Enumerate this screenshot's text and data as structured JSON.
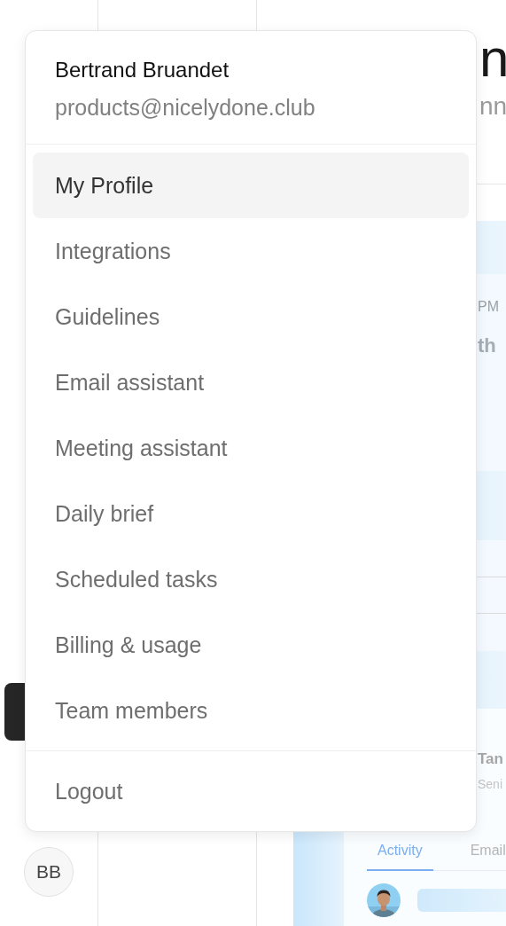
{
  "sidebar": {
    "avatar_initials": "BB"
  },
  "main": {
    "heading": "n",
    "subtitle": "nn",
    "event_time": "PM",
    "event_title": "th",
    "contact_name": "Tan",
    "contact_role": "Seni",
    "tabs": [
      {
        "label": "Activity",
        "selected": true
      },
      {
        "label": "Email",
        "selected": false
      }
    ]
  },
  "user_menu": {
    "name": "Bertrand Bruandet",
    "email": "products@nicelydone.club",
    "items": [
      {
        "label": "My Profile",
        "selected": true
      },
      {
        "label": "Integrations",
        "selected": false
      },
      {
        "label": "Guidelines",
        "selected": false
      },
      {
        "label": "Email assistant",
        "selected": false
      },
      {
        "label": "Meeting assistant",
        "selected": false
      },
      {
        "label": "Daily brief",
        "selected": false
      },
      {
        "label": "Scheduled tasks",
        "selected": false
      },
      {
        "label": "Billing & usage",
        "selected": false
      },
      {
        "label": "Team members",
        "selected": false
      }
    ],
    "logout": "Logout"
  }
}
